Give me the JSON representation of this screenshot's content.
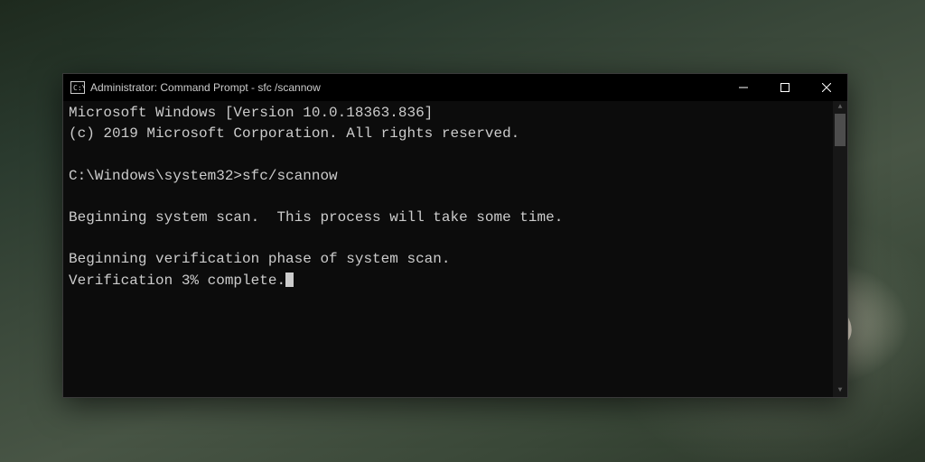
{
  "titlebar": {
    "title": "Administrator: Command Prompt - sfc /scannow"
  },
  "terminal": {
    "version_line": "Microsoft Windows [Version 10.0.18363.836]",
    "copyright_line": "(c) 2019 Microsoft Corporation. All rights reserved.",
    "prompt_line": "C:\\Windows\\system32>sfc/scannow",
    "scan_begin_line": "Beginning system scan.  This process will take some time.",
    "verify_begin_line": "Beginning verification phase of system scan.",
    "verify_progress_line": "Verification 3% complete."
  }
}
